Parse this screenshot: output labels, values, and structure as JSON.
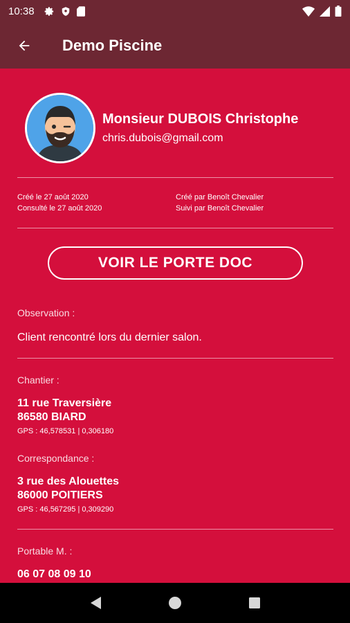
{
  "status_bar": {
    "time": "10:38"
  },
  "app_bar": {
    "title": "Demo Piscine"
  },
  "client": {
    "name": "Monsieur DUBOIS Christophe",
    "email": "chris.dubois@gmail.com"
  },
  "meta": {
    "created": "Créé le 27 août 2020",
    "viewed": "Consulté le 27 août 2020",
    "created_by": "Créé par Benoît Chevalier",
    "followed_by": "Suivi par Benoît Chevalier"
  },
  "portfolio_button": "VOIR LE PORTE DOC",
  "observation": {
    "label": "Observation :",
    "text": "Client rencontré lors du dernier salon."
  },
  "chantier": {
    "label": "Chantier :",
    "street": "11 rue Traversière",
    "city": "86580 BIARD",
    "gps": "GPS : 46,578531 | 0,306180"
  },
  "correspondance": {
    "label": "Correspondance :",
    "street": "3 rue des Alouettes",
    "city": "86000 POITIERS",
    "gps": "GPS : 46,567295 | 0,309290"
  },
  "phone": {
    "label": "Portable M. :",
    "number": "06 07 08 09 10"
  },
  "colors": {
    "background": "#d40f3c",
    "app_bar": "#6d2733",
    "nav_bar": "#000000"
  }
}
